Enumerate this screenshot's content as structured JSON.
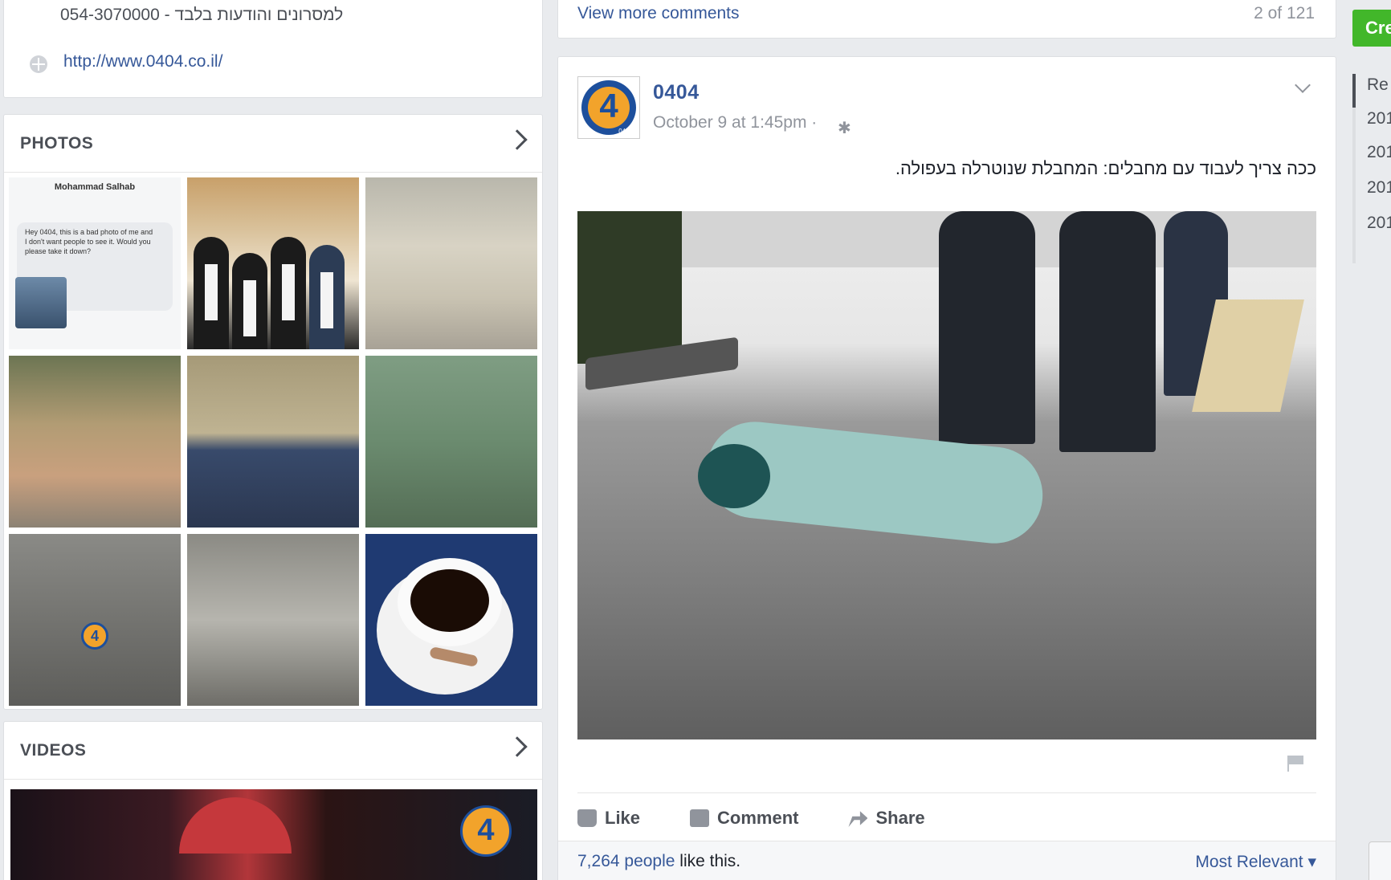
{
  "about": {
    "phone_line": "054-3070000 - למסרונים והודעות בלבד",
    "website": "http://www.0404.co.il/"
  },
  "photos": {
    "title": "PHOTOS",
    "screenshot_header": "Mohammad Salhab",
    "screenshot_message": "Hey 0404, this is a bad photo of me and I don't want people to see it. Would you please take it down?"
  },
  "videos": {
    "title": "VIDEOS"
  },
  "comments_bar": {
    "view_more": "View more comments",
    "count": "2 of 121"
  },
  "post": {
    "page_name": "0404",
    "avatar_text": "4",
    "avatar_small": "0404",
    "timestamp": "October 9 at 1:45pm",
    "separator": "·",
    "text": "ככה צריך לעבוד עם מחבלים: המחבלת שנוטרלה בעפולה.",
    "actions": {
      "like": "Like",
      "comment": "Comment",
      "share": "Share"
    },
    "likes_count": "7,264 people",
    "likes_suffix": " like this.",
    "sort_label": "Most Relevant ▾"
  },
  "sidebar": {
    "create_label": "Cre",
    "years": [
      "Re",
      "201",
      "201",
      "201",
      "201"
    ]
  },
  "colors": {
    "link": "#365899",
    "create_green": "#42b72a",
    "logo_orange": "#f2a32b",
    "logo_blue": "#1d4f9c"
  }
}
